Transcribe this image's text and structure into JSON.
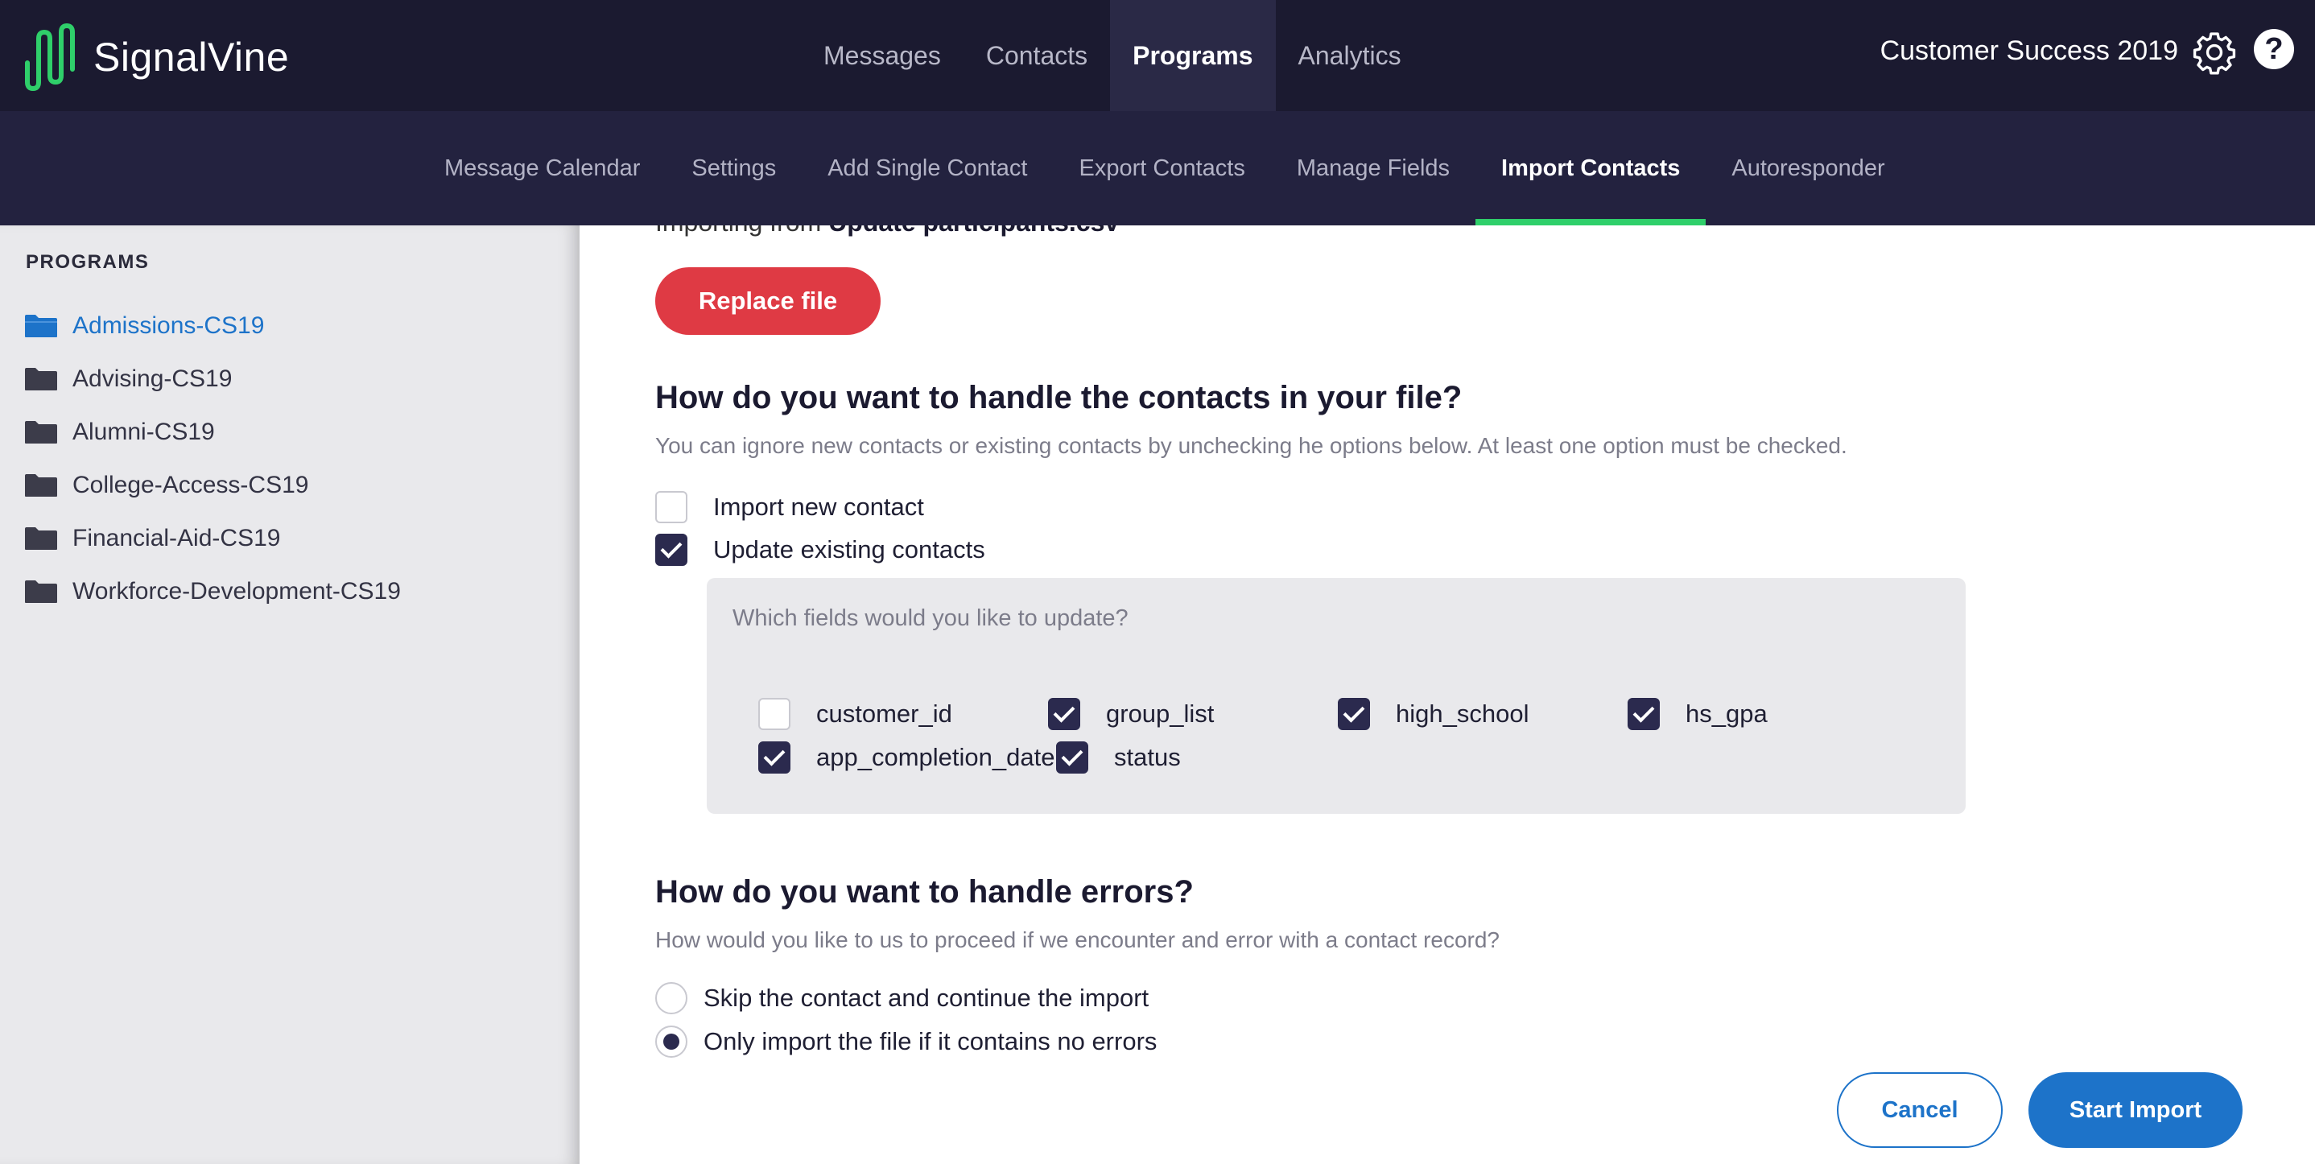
{
  "brand": {
    "name": "SignalVine",
    "logo_icon": "signal-wave-icon",
    "accent": "#2fcf6a"
  },
  "main_nav": {
    "items": [
      {
        "label": "Messages",
        "active": false
      },
      {
        "label": "Contacts",
        "active": false
      },
      {
        "label": "Programs",
        "active": true
      },
      {
        "label": "Analytics",
        "active": false
      }
    ]
  },
  "account": {
    "name": "Customer Success 2019",
    "settings_icon": "gear-icon",
    "help_icon": "question-icon"
  },
  "sub_nav": {
    "items": [
      {
        "label": "Message Calendar",
        "active": false
      },
      {
        "label": "Settings",
        "active": false
      },
      {
        "label": "Add Single Contact",
        "active": false
      },
      {
        "label": "Export Contacts",
        "active": false
      },
      {
        "label": "Manage Fields",
        "active": false
      },
      {
        "label": "Import Contacts",
        "active": true
      },
      {
        "label": "Autoresponder",
        "active": false
      }
    ]
  },
  "sidebar": {
    "heading": "PROGRAMS",
    "items": [
      {
        "label": "Admissions-CS19",
        "active": true,
        "icon": "folder-open-icon"
      },
      {
        "label": "Advising-CS19",
        "active": false,
        "icon": "folder-icon"
      },
      {
        "label": "Alumni-CS19",
        "active": false,
        "icon": "folder-icon"
      },
      {
        "label": "College-Access-CS19",
        "active": false,
        "icon": "folder-icon"
      },
      {
        "label": "Financial-Aid-CS19",
        "active": false,
        "icon": "folder-icon"
      },
      {
        "label": "Workforce-Development-CS19",
        "active": false,
        "icon": "folder-icon"
      }
    ]
  },
  "import": {
    "importing_prefix": "Importing from",
    "file_name": "Update participants.csv",
    "replace_button": "Replace file",
    "contacts_heading": "How do you want to handle the contacts in your file?",
    "contacts_help": "You can ignore new contacts or existing contacts by unchecking he options below. At least one option must be checked.",
    "options": [
      {
        "label": "Import new contact",
        "checked": false
      },
      {
        "label": "Update existing contacts",
        "checked": true
      }
    ],
    "fields_question": "Which fields would you like to update?",
    "fields": [
      {
        "label": "customer_id",
        "checked": false
      },
      {
        "label": "group_list",
        "checked": true
      },
      {
        "label": "high_school",
        "checked": true
      },
      {
        "label": "hs_gpa",
        "checked": true
      },
      {
        "label": "app_completion_date",
        "checked": true
      },
      {
        "label": "status",
        "checked": true
      }
    ],
    "errors_heading": "How do you want to handle errors?",
    "errors_help": "How would you like to us to proceed if we encounter and error with a contact record?",
    "error_options": [
      {
        "label": "Skip the contact and continue the import",
        "selected": false
      },
      {
        "label": "Only import the file if it contains no errors",
        "selected": true
      }
    ],
    "cancel_button": "Cancel",
    "start_button": "Start Import"
  },
  "colors": {
    "header_bg": "#1b1a30",
    "subnav_bg": "#23223f",
    "primary": "#1d73c9",
    "danger": "#df3a44",
    "checkbox": "#2b2a4e"
  }
}
